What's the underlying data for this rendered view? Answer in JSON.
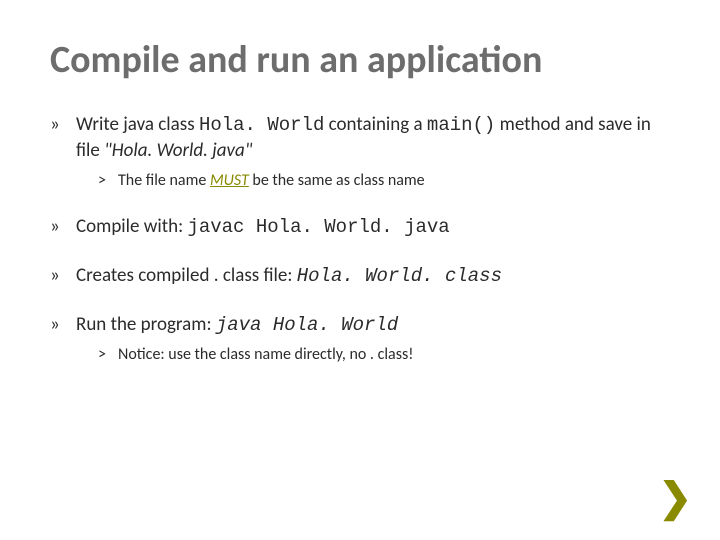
{
  "title": "Compile and run an application",
  "bullets": [
    {
      "parts": [
        "Write java class ",
        {
          "t": "Hola. World",
          "cls": "mono"
        },
        " containing a ",
        {
          "t": "main()",
          "cls": "mono"
        },
        " method and save in file ",
        {
          "t": "\"Hola. World. java\"",
          "cls": "ital"
        }
      ],
      "sub": [
        {
          "parts": [
            "The file name ",
            {
              "t": "MUST",
              "cls": "must"
            },
            " be the same as class name"
          ]
        }
      ]
    },
    {
      "parts": [
        "Compile with: ",
        {
          "t": "javac Hola. World. java",
          "cls": "mono"
        }
      ]
    },
    {
      "parts": [
        "Creates compiled . class file: ",
        {
          "t": "Hola. World. class",
          "cls": "mono ital"
        }
      ]
    },
    {
      "parts": [
        "Run the program: ",
        {
          "t": "java  Hola. World",
          "cls": "mono ital"
        }
      ],
      "sub": [
        {
          "parts": [
            "Notice: use the class name directly, no . class!"
          ]
        }
      ]
    }
  ],
  "nextGlyph": "❯"
}
